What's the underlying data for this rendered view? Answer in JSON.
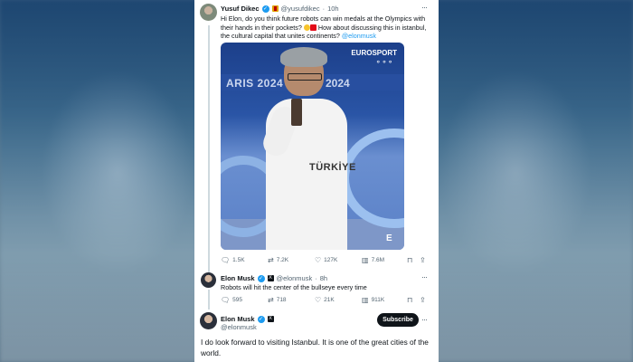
{
  "tweet1": {
    "name": "Yusuf Dikec",
    "handle": "@yusufdikec",
    "time": "10h",
    "text_pre": "Hi Elon, do you think future robots can win medals at the Olympics with their hands in their pockets? ",
    "text_mid": " How about discussing this in istanbul, the cultural capital that unites continents? ",
    "mention": "@elonmusk",
    "media": {
      "paris_left": "ARIS 2024",
      "paris_right": "2024",
      "broadcaster": "EUROSPORT",
      "jersey": "TÜRKİYE"
    },
    "stats": {
      "replies": "1.5K",
      "retweets": "7.2K",
      "likes": "127K",
      "views": "7.6M"
    }
  },
  "tweet2": {
    "name": "Elon Musk",
    "handle": "@elonmusk",
    "time": "8h",
    "text": "Robots will hit the center of the bullseye every time",
    "stats": {
      "replies": "595",
      "retweets": "718",
      "likes": "21K",
      "views": "911K"
    }
  },
  "tweet3": {
    "name": "Elon Musk",
    "handle": "@elonmusk",
    "subscribe_label": "Subscribe",
    "text": "I do look forward to visiting Istanbul. It is one of the great cities of the world."
  },
  "icons": {
    "reply": "reply-icon",
    "retweet": "retweet-icon",
    "like": "heart-icon",
    "views": "views-icon",
    "bookmark": "bookmark-icon",
    "share": "share-icon"
  },
  "colors": {
    "accent": "#1d9bf0",
    "text": "#0f1419",
    "muted": "#536471"
  }
}
